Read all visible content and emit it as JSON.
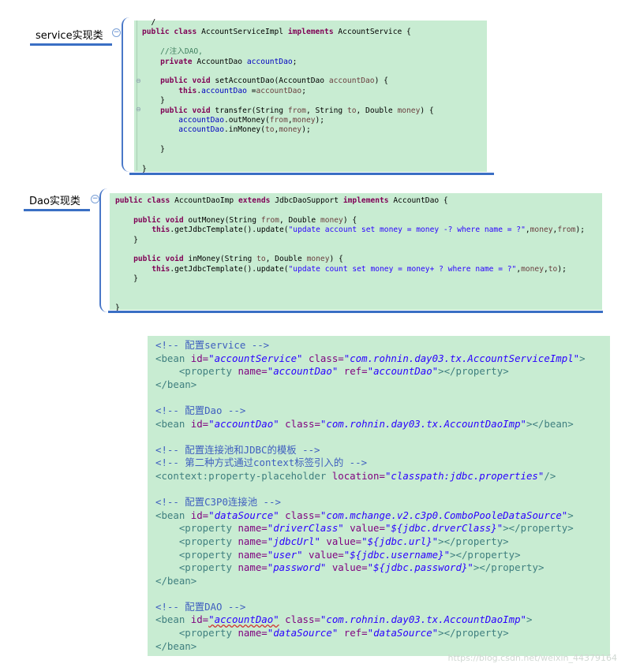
{
  "mindmap": {
    "service_node": {
      "label": "service实现类"
    },
    "dao_node": {
      "label": "Dao实现类"
    }
  },
  "service_code": [
    [
      [
        "plain",
        "  /"
      ]
    ],
    [
      [
        "kw",
        "public class "
      ],
      [
        "plain",
        "AccountServiceImpl "
      ],
      [
        "kw",
        "implements "
      ],
      [
        "plain",
        "AccountService {"
      ]
    ],
    [
      [
        "plain",
        ""
      ]
    ],
    [
      [
        "cmt",
        "    //注入DAO,"
      ]
    ],
    [
      [
        "plain",
        "    "
      ],
      [
        "kw",
        "private "
      ],
      [
        "plain",
        "AccountDao "
      ],
      [
        "field",
        "accountDao"
      ],
      [
        "plain",
        ";"
      ]
    ],
    [
      [
        "plain",
        ""
      ]
    ],
    [
      [
        "plain",
        "    "
      ],
      [
        "kw",
        "public void "
      ],
      [
        "plain",
        "setAccountDao(AccountDao "
      ],
      [
        "param",
        "accountDao"
      ],
      [
        "plain",
        ") {"
      ]
    ],
    [
      [
        "plain",
        "        "
      ],
      [
        "kw",
        "this"
      ],
      [
        "plain",
        "."
      ],
      [
        "field",
        "accountDao"
      ],
      [
        "plain",
        " ="
      ],
      [
        "param",
        "accountDao"
      ],
      [
        "plain",
        ";"
      ]
    ],
    [
      [
        "plain",
        "    }"
      ]
    ],
    [
      [
        "plain",
        "    "
      ],
      [
        "kw",
        "public void "
      ],
      [
        "plain",
        "transfer(String "
      ],
      [
        "param",
        "from"
      ],
      [
        "plain",
        ", String "
      ],
      [
        "param",
        "to"
      ],
      [
        "plain",
        ", Double "
      ],
      [
        "param",
        "money"
      ],
      [
        "plain",
        ") {"
      ]
    ],
    [
      [
        "plain",
        "        "
      ],
      [
        "field",
        "accountDao"
      ],
      [
        "plain",
        ".outMoney("
      ],
      [
        "param",
        "from"
      ],
      [
        "plain",
        ","
      ],
      [
        "param",
        "money"
      ],
      [
        "plain",
        ");"
      ]
    ],
    [
      [
        "plain",
        "        "
      ],
      [
        "field",
        "accountDao"
      ],
      [
        "plain",
        ".inMoney("
      ],
      [
        "param",
        "to"
      ],
      [
        "plain",
        ","
      ],
      [
        "param",
        "money"
      ],
      [
        "plain",
        ");"
      ]
    ],
    [
      [
        "plain",
        ""
      ]
    ],
    [
      [
        "plain",
        "    }"
      ]
    ],
    [
      [
        "plain",
        ""
      ]
    ],
    [
      [
        "plain",
        "}"
      ]
    ]
  ],
  "dao_code": [
    [
      [
        "kw",
        "public class "
      ],
      [
        "plain",
        "AccountDaoImp "
      ],
      [
        "kw",
        "extends "
      ],
      [
        "plain",
        "JdbcDaoSupport "
      ],
      [
        "kw",
        "implements "
      ],
      [
        "plain",
        "AccountDao {"
      ]
    ],
    [
      [
        "plain",
        ""
      ]
    ],
    [
      [
        "plain",
        "    "
      ],
      [
        "kw",
        "public void "
      ],
      [
        "plain",
        "outMoney(String "
      ],
      [
        "param",
        "from"
      ],
      [
        "plain",
        ", Double "
      ],
      [
        "param",
        "money"
      ],
      [
        "plain",
        ") {"
      ]
    ],
    [
      [
        "plain",
        "        "
      ],
      [
        "kw",
        "this"
      ],
      [
        "plain",
        ".getJdbcTemplate().update("
      ],
      [
        "str",
        "\"update account set money = money -? where name = ?\""
      ],
      [
        "plain",
        ","
      ],
      [
        "param",
        "money"
      ],
      [
        "plain",
        ","
      ],
      [
        "param",
        "from"
      ],
      [
        "plain",
        ");"
      ]
    ],
    [
      [
        "plain",
        "    }"
      ]
    ],
    [
      [
        "plain",
        ""
      ]
    ],
    [
      [
        "plain",
        "    "
      ],
      [
        "kw",
        "public void "
      ],
      [
        "plain",
        "inMoney(String "
      ],
      [
        "param",
        "to"
      ],
      [
        "plain",
        ", Double "
      ],
      [
        "param",
        "money"
      ],
      [
        "plain",
        ") {"
      ]
    ],
    [
      [
        "plain",
        "        "
      ],
      [
        "kw",
        "this"
      ],
      [
        "plain",
        ".getJdbcTemplate().update("
      ],
      [
        "str",
        "\"update count set money = money+ ? where name = ?\""
      ],
      [
        "plain",
        ","
      ],
      [
        "param",
        "money"
      ],
      [
        "plain",
        ","
      ],
      [
        "param",
        "to"
      ],
      [
        "plain",
        ");"
      ]
    ],
    [
      [
        "plain",
        "    }"
      ]
    ],
    [
      [
        "plain",
        ""
      ]
    ],
    [
      [
        "plain",
        ""
      ]
    ],
    [
      [
        "plain",
        "}"
      ]
    ]
  ],
  "xml_code": [
    [
      [
        "xcmt",
        "<!-- 配置service -->"
      ]
    ],
    [
      [
        "xtag",
        "<bean "
      ],
      [
        "xattr",
        "id="
      ],
      [
        "xval",
        "\"accountService\""
      ],
      [
        "plain",
        " "
      ],
      [
        "xattr",
        "class="
      ],
      [
        "xval",
        "\"com.rohnin.day03.tx.AccountServiceImpl\""
      ],
      [
        "xtag",
        ">"
      ]
    ],
    [
      [
        "plain",
        "    "
      ],
      [
        "xtag",
        "<property "
      ],
      [
        "xattr",
        "name="
      ],
      [
        "xval",
        "\"accountDao\""
      ],
      [
        "plain",
        " "
      ],
      [
        "xattr",
        "ref="
      ],
      [
        "xval",
        "\"accountDao\""
      ],
      [
        "xtag",
        "></property>"
      ]
    ],
    [
      [
        "xtag",
        "</bean>"
      ]
    ],
    [
      [
        "plain",
        ""
      ]
    ],
    [
      [
        "xcmt",
        "<!-- 配置Dao -->"
      ]
    ],
    [
      [
        "xtag",
        "<bean "
      ],
      [
        "xattr",
        "id="
      ],
      [
        "xval",
        "\"accountDao\""
      ],
      [
        "plain",
        " "
      ],
      [
        "xattr",
        "class="
      ],
      [
        "xval",
        "\"com.rohnin.day03.tx.AccountDaoImp\""
      ],
      [
        "xtag",
        "></bean>"
      ]
    ],
    [
      [
        "plain",
        ""
      ]
    ],
    [
      [
        "xcmt",
        "<!-- 配置连接池和JDBC的模板 -->"
      ]
    ],
    [
      [
        "xcmt",
        "<!-- 第二种方式通过context标签引入的 -->"
      ]
    ],
    [
      [
        "xtag",
        "<context:property-placeholder "
      ],
      [
        "xattr",
        "location="
      ],
      [
        "xval",
        "\"classpath:jdbc.properties\""
      ],
      [
        "xtag",
        "/>"
      ]
    ],
    [
      [
        "plain",
        ""
      ]
    ],
    [
      [
        "xcmt",
        "<!-- 配置C3P0连接池 -->"
      ]
    ],
    [
      [
        "xtag",
        "<bean "
      ],
      [
        "xattr",
        "id="
      ],
      [
        "xval",
        "\"dataSource\""
      ],
      [
        "plain",
        " "
      ],
      [
        "xattr",
        "class="
      ],
      [
        "xval",
        "\"com.mchange.v2.c3p0.ComboPooleDataSource\""
      ],
      [
        "xtag",
        ">"
      ]
    ],
    [
      [
        "plain",
        "    "
      ],
      [
        "xtag",
        "<property "
      ],
      [
        "xattr",
        "name="
      ],
      [
        "xval",
        "\"driverClass\""
      ],
      [
        "plain",
        " "
      ],
      [
        "xattr",
        "value="
      ],
      [
        "xval",
        "\"${jdbc.drverClass}\""
      ],
      [
        "xtag",
        "></property>"
      ]
    ],
    [
      [
        "plain",
        "    "
      ],
      [
        "xtag",
        "<property "
      ],
      [
        "xattr",
        "name="
      ],
      [
        "xval",
        "\"jdbcUrl\""
      ],
      [
        "plain",
        " "
      ],
      [
        "xattr",
        "value="
      ],
      [
        "xval",
        "\"${jdbc.url}\""
      ],
      [
        "xtag",
        "></property>"
      ]
    ],
    [
      [
        "plain",
        "    "
      ],
      [
        "xtag",
        "<property "
      ],
      [
        "xattr",
        "name="
      ],
      [
        "xval",
        "\"user\""
      ],
      [
        "plain",
        " "
      ],
      [
        "xattr",
        "value="
      ],
      [
        "xval",
        "\"${jdbc.username}\""
      ],
      [
        "xtag",
        "></property>"
      ]
    ],
    [
      [
        "plain",
        "    "
      ],
      [
        "xtag",
        "<property "
      ],
      [
        "xattr",
        "name="
      ],
      [
        "xval",
        "\"password\""
      ],
      [
        "plain",
        " "
      ],
      [
        "xattr",
        "value="
      ],
      [
        "xval",
        "\"${jdbc.password}\""
      ],
      [
        "xtag",
        "></property>"
      ]
    ],
    [
      [
        "xtag",
        "</bean>"
      ]
    ],
    [
      [
        "plain",
        ""
      ]
    ],
    [
      [
        "xcmt",
        "<!-- 配置DAO -->"
      ]
    ],
    [
      [
        "xtag",
        "<bean "
      ],
      [
        "xattr",
        "id="
      ],
      [
        "xval",
        "\"accountDao\""
      ],
      [
        "plain",
        " "
      ],
      [
        "xattr",
        "class="
      ],
      [
        "xval",
        "\"com.rohnin.day03.tx.AccountDaoImp\""
      ],
      [
        "xtag",
        ">"
      ]
    ],
    [
      [
        "plain",
        "    "
      ],
      [
        "xtag",
        "<property "
      ],
      [
        "xattr",
        "name="
      ],
      [
        "xval",
        "\"dataSource\""
      ],
      [
        "plain",
        " "
      ],
      [
        "xattr",
        "ref="
      ],
      [
        "xval",
        "\"dataSource\""
      ],
      [
        "xtag",
        "></property>"
      ]
    ],
    [
      [
        "xtag",
        "</bean>"
      ]
    ]
  ],
  "watermark": "https://blog.csdn.net/weixin_44379164",
  "colors": {
    "panel_bg": "#c8ecd2",
    "connector": "#4a78c8",
    "keyword": "#7f0055",
    "field": "#0000c0",
    "string": "#2a00ff",
    "xml_comment": "#3f5fbf",
    "xml_tag": "#3f7f7f",
    "xml_attr": "#7f007f"
  }
}
